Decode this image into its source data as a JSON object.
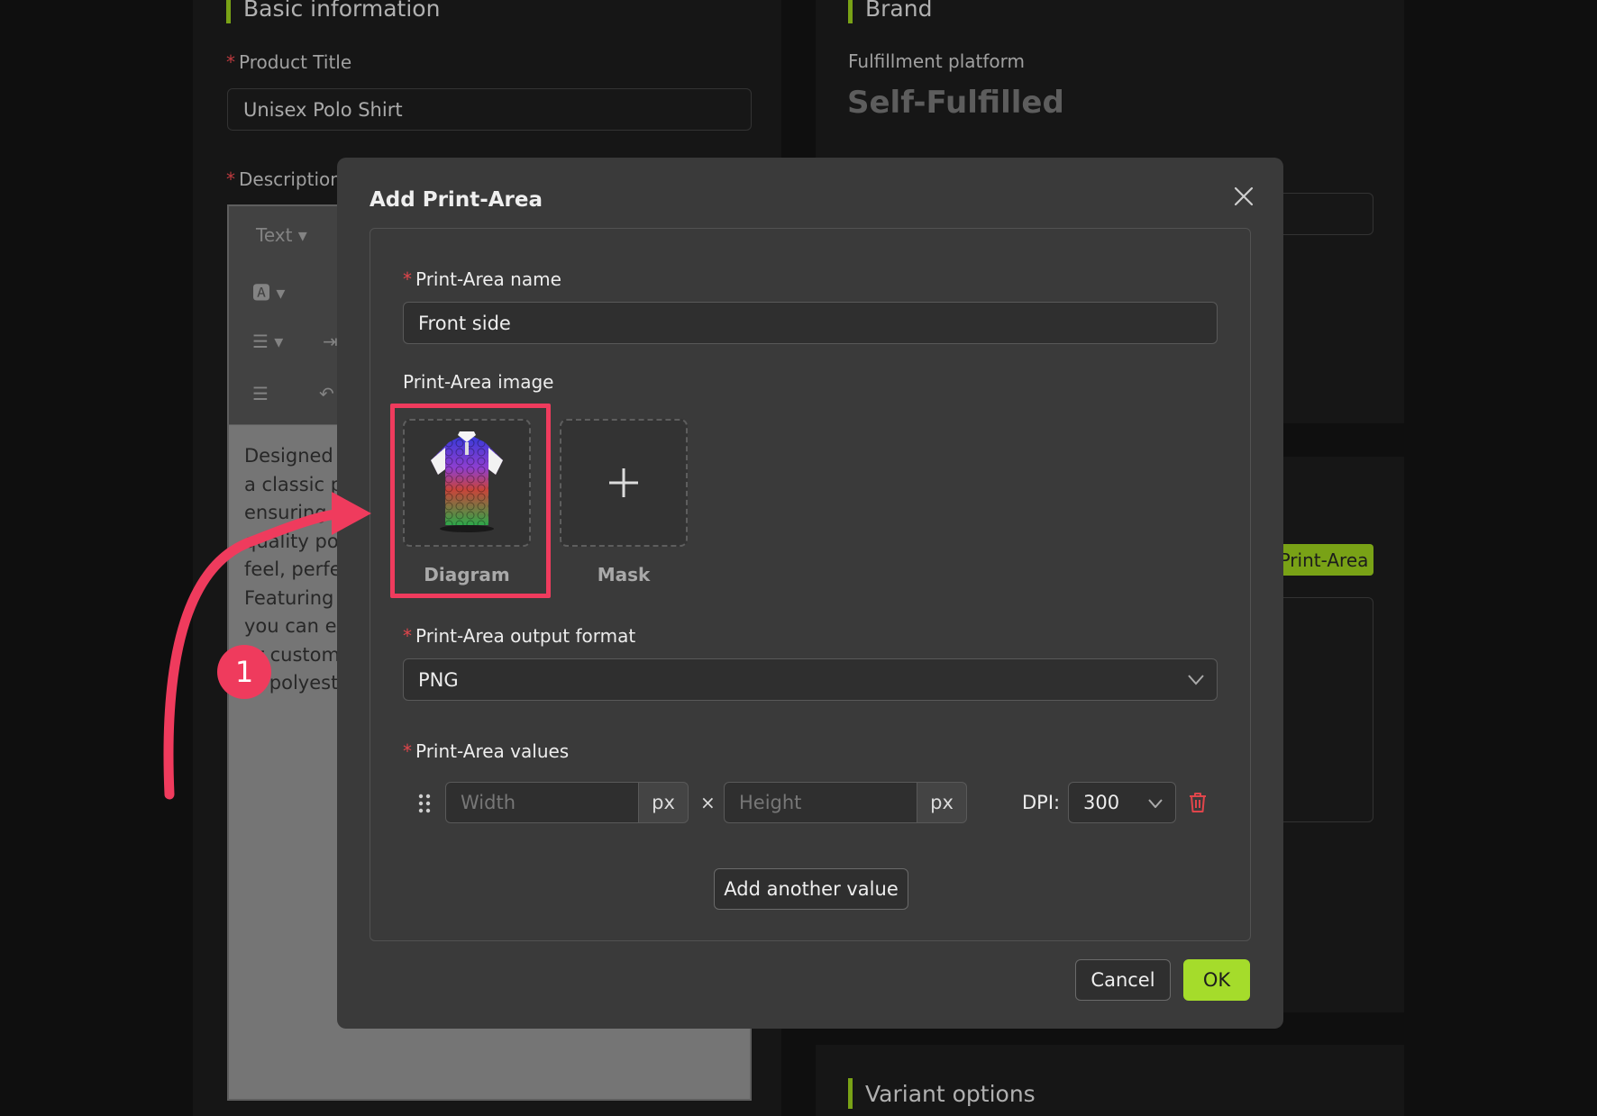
{
  "background": {
    "basic_info_heading": "Basic information",
    "product_title_label": "Product Title",
    "product_title_value": "Unisex Polo Shirt",
    "description_label": "Description",
    "editor_toolbar_text": "Text",
    "editor_lines": [
      "Designed fo",
      "a classic po",
      "ensuring",
      "quality poly",
      "feel, perfect",
      "Featuring y",
      "you can exp",
      "ur custom",
      "at polyest"
    ],
    "brand_heading": "Brand",
    "fulfillment_label": "Fulfillment platform",
    "fulfillment_value": "Self-Fulfilled",
    "print_area_tag": "Print-Area",
    "variant_heading": "Variant options"
  },
  "modal": {
    "title": "Add Print-Area",
    "name_label": "Print-Area name",
    "name_value": "Front side",
    "image_label": "Print-Area image",
    "diagram_caption": "Diagram",
    "mask_caption": "Mask",
    "format_label": "Print-Area output format",
    "format_value": "PNG",
    "values_label": "Print-Area values",
    "width_placeholder": "Width",
    "height_placeholder": "Height",
    "unit": "px",
    "times": "×",
    "dpi_label": "DPI:",
    "dpi_value": "300",
    "add_value_label": "Add another value",
    "cancel_label": "Cancel",
    "ok_label": "OK"
  },
  "annotation": {
    "step_number": "1",
    "highlight_color": "#ef3b5d"
  },
  "colors": {
    "accent": "#8fbf1a",
    "primary_button": "#a5dc2b",
    "required_star": "#e0454b",
    "delete_icon": "#e0454b"
  }
}
